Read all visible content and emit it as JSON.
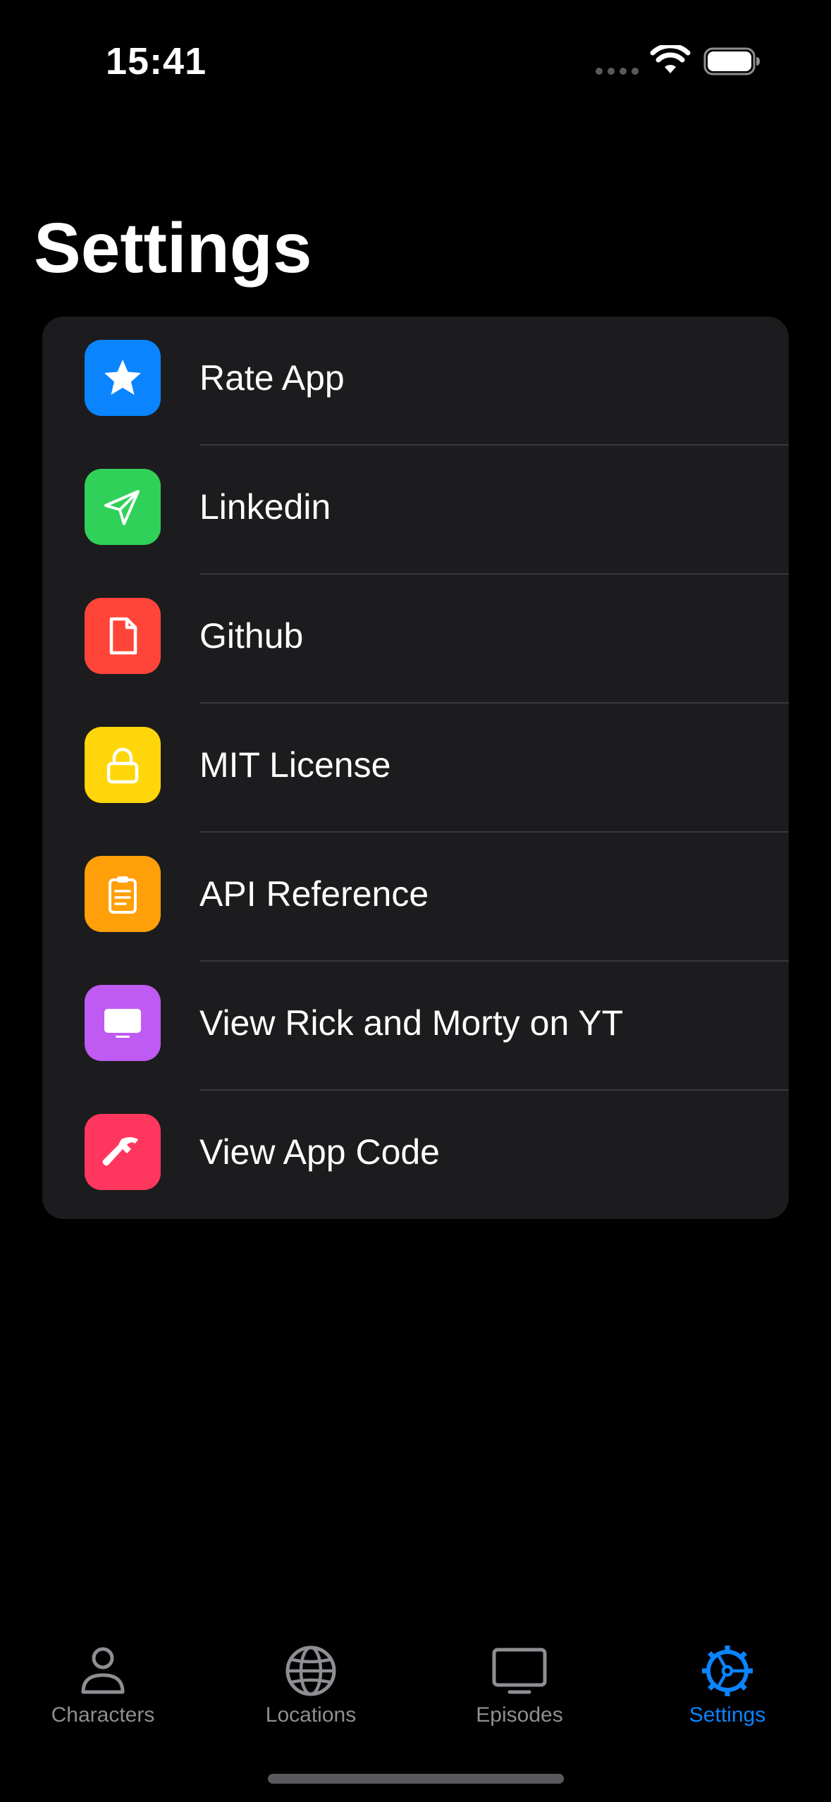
{
  "status_bar": {
    "time": "15:41"
  },
  "page": {
    "title": "Settings"
  },
  "settings": {
    "items": [
      {
        "label": "Rate App",
        "icon": "star-icon",
        "color": "#0a84ff"
      },
      {
        "label": "Linkedin",
        "icon": "paperplane-icon",
        "color": "#30d158"
      },
      {
        "label": "Github",
        "icon": "document-icon",
        "color": "#ff453a"
      },
      {
        "label": "MIT License",
        "icon": "lock-icon",
        "color": "#ffd60a"
      },
      {
        "label": "API Reference",
        "icon": "clipboard-icon",
        "color": "#ff9f0a"
      },
      {
        "label": "View Rick and Morty on YT",
        "icon": "tv-icon",
        "color": "#bf5af2"
      },
      {
        "label": "View App Code",
        "icon": "hammer-icon",
        "color": "#ff375f"
      }
    ]
  },
  "tab_bar": {
    "active_color": "#0a84ff",
    "inactive_color": "#8e8e93",
    "tabs": [
      {
        "label": "Characters",
        "icon": "person-icon",
        "active": false
      },
      {
        "label": "Locations",
        "icon": "globe-icon",
        "active": false
      },
      {
        "label": "Episodes",
        "icon": "tv-icon",
        "active": false
      },
      {
        "label": "Settings",
        "icon": "gear-icon",
        "active": true
      }
    ]
  }
}
